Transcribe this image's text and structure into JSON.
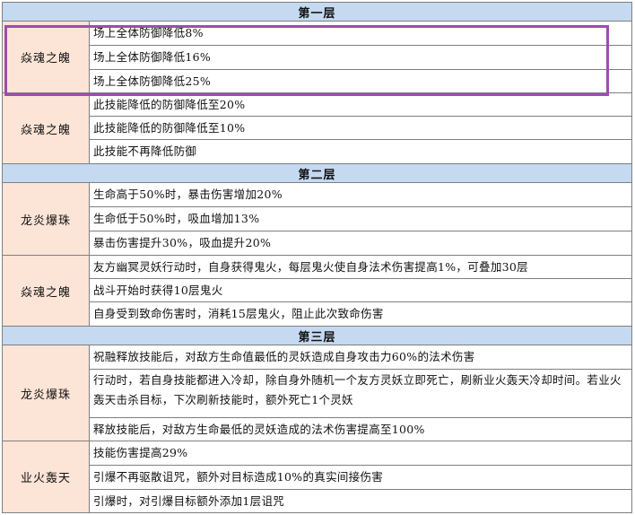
{
  "sections": [
    {
      "title": "第一层",
      "groups": [
        {
          "name": "焱魂之魄",
          "rows": [
            "场上全体防御降低8%",
            "场上全体防御降低16%",
            "场上全体防御降低25%"
          ]
        },
        {
          "name": "焱魂之魄",
          "rows": [
            "此技能降低的防御降低至20%",
            "此技能降低的防御降低至10%",
            "此技能不再降低防御"
          ]
        }
      ]
    },
    {
      "title": "第二层",
      "groups": [
        {
          "name": "龙炎爆珠",
          "rows": [
            "生命高于50%时，暴击伤害增加20%",
            "生命低于50%时，吸血增加13%",
            "暴击伤害提升30%，吸血提升20%"
          ]
        },
        {
          "name": "焱魂之魄",
          "rows": [
            "友方幽冥灵妖行动时，自身获得鬼火，每层鬼火使自身法术伤害提高1%，可叠加30层",
            "战斗开始时获得10层鬼火",
            "自身受到致命伤害时，消耗15层鬼火，阻止此次致命伤害"
          ]
        }
      ]
    },
    {
      "title": "第三层",
      "groups": [
        {
          "name": "龙炎爆珠",
          "rows": [
            "祝融释放技能后，对敌方生命值最低的灵妖造成自身攻击力60%的法术伤害",
            "行动时，若自身技能都进入冷却，除自身外随机一个友方灵妖立即死亡，刷新业火轰天冷却时间。若业火轰天击杀目标，下次刷新技能时，额外死亡1个灵妖",
            "释放技能后，对敌方生命最低的灵妖造成的法术伤害提高至100%"
          ]
        },
        {
          "name": "业火轰天",
          "rows": [
            "技能伤害提高29%",
            "引爆不再驱散诅咒，额外对目标造成10%的真实间接伤害",
            "引爆时，对引爆目标额外添加1层诅咒"
          ]
        }
      ]
    }
  ]
}
